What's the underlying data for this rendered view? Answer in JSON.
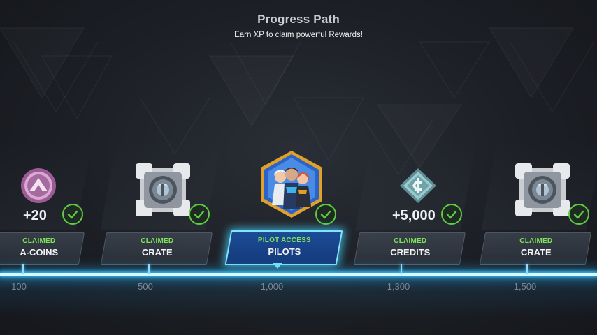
{
  "header": {
    "title": "Progress Path",
    "subtitle": "Earn XP to claim powerful Rewards!"
  },
  "rewards": [
    {
      "amount": "+20",
      "status": "CLAIMED",
      "name": "A-COINS",
      "xp": "100",
      "icon": "a-coin-icon"
    },
    {
      "amount": "",
      "status": "CLAIMED",
      "name": "CRATE",
      "xp": "500",
      "icon": "crate-icon"
    },
    {
      "amount": "",
      "status": "PILOT ACCESS",
      "name": "PILOTS",
      "xp": "1,000",
      "icon": "pilots-portrait-icon"
    },
    {
      "amount": "+5,000",
      "status": "CLAIMED",
      "name": "CREDITS",
      "xp": "1,300",
      "icon": "credits-icon"
    },
    {
      "amount": "",
      "status": "CLAIMED",
      "name": "CRATE",
      "xp": "1,500",
      "icon": "crate-icon"
    }
  ],
  "colors": {
    "claimed_green": "#7ee35a",
    "track_glow": "#38c8ff",
    "active_card": "#1c4c98",
    "acoin_purple": "#b77ab0",
    "credits_teal": "#6fa3a8"
  }
}
